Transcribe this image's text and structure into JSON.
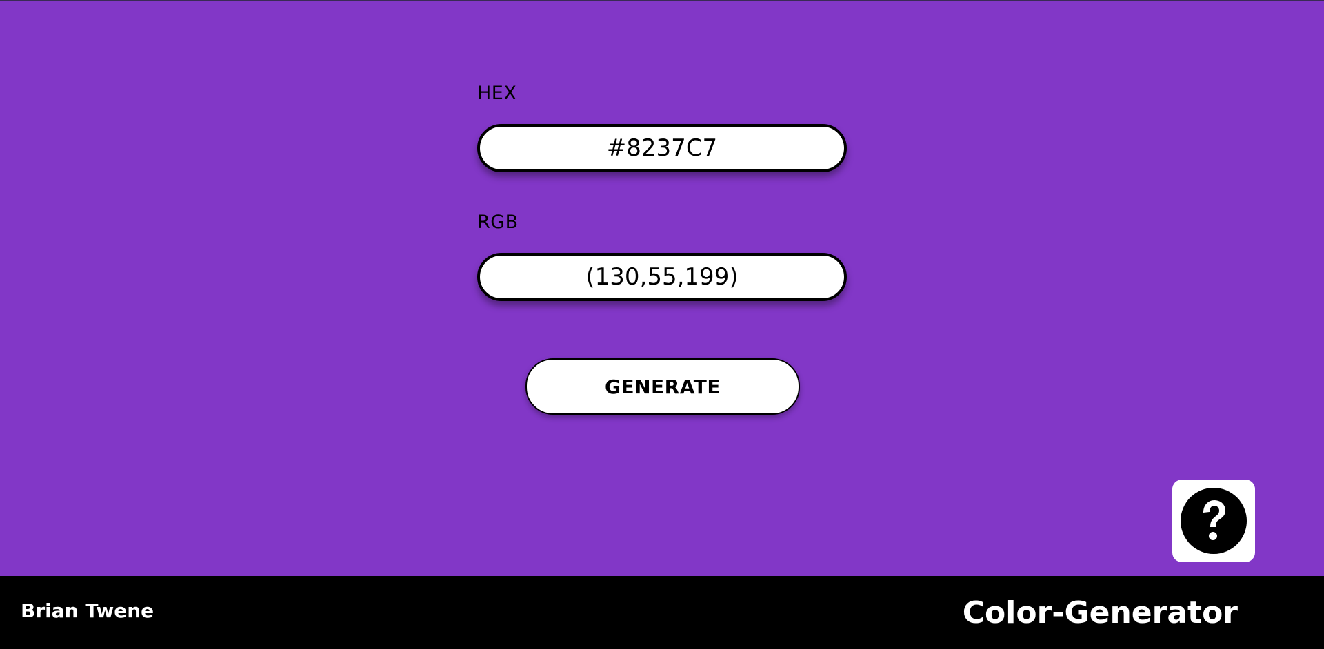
{
  "colors": {
    "background": "#8237C7",
    "footer": "#000000",
    "field_bg": "#ffffff"
  },
  "form": {
    "hex_label": "HEX",
    "hex_value": "#8237C7",
    "rgb_label": "RGB",
    "rgb_value": "(130,55,199)"
  },
  "generate_label": "GENERATE",
  "help_icon": "question-circle-icon",
  "footer": {
    "author": "Brian Twene",
    "app_title": "Color-Generator"
  }
}
